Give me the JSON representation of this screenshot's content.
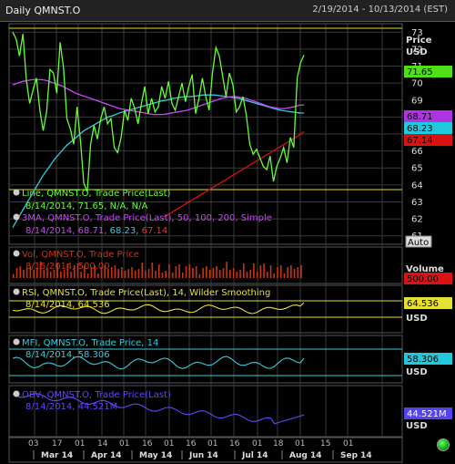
{
  "window": {
    "title": "Daily QMNST.O",
    "range": "2/19/2014 - 10/13/2014 (EST)"
  },
  "colors": {
    "background": "#000000",
    "grid": "#3a3a3a",
    "frame": "#e0e020",
    "price_line": "#66ff33",
    "ma50": "#cc44ff",
    "ma100": "#33ccdd",
    "ma200": "#dd1111",
    "volume": "#cc3311",
    "rsi": "#e6e033",
    "mfi": "#33ccdd",
    "obv": "#6644ff",
    "status_light": "#22cc22"
  },
  "price_panel": {
    "axis_title": "Price",
    "axis_unit": "USD",
    "auto_button": "Auto",
    "ticks": [
      "73",
      "72",
      "71",
      "70",
      "69",
      "68",
      "67",
      "66",
      "65",
      "64",
      "63",
      "62",
      "61"
    ],
    "legend_line1": "Line, QMNST.O, Trade Price(Last)",
    "legend_line1_vals": "8/14/2014, 71.65, N/A, N/A",
    "legend_line2": "3MA, QMNST.O, Trade Price(Last), 50, 100, 200, Simple",
    "legend_line2_date": "8/14/2014",
    "legend_ma50": "68.71",
    "legend_ma100": "68.23",
    "legend_ma200": "67.14",
    "badge_last": "71.65",
    "badge_ma50": "68.71",
    "badge_ma100": "68.23",
    "badge_ma200": "67.14"
  },
  "volume_panel": {
    "legend": "Vol, QMNST.O, Trade Price",
    "legend_vals": "8/15/2014, 500.00",
    "axis_title": "Volume",
    "badge": "500.00"
  },
  "rsi_panel": {
    "legend": "RSI, QMNST.O, Trade Price(Last), 14, Wilder Smoothing",
    "legend_vals": "8/14/2014, 64.536",
    "badge": "64.536",
    "unit": "USD"
  },
  "mfi_panel": {
    "legend": "MFI, QMNST.O, Trade Price, 14",
    "legend_vals": "8/14/2014, 58.306",
    "badge": "58.306",
    "unit": "USD"
  },
  "obv_panel": {
    "legend": "OBV, QMNST.O, Trade Price(Last)",
    "legend_vals": "8/14/2014, 44.521M",
    "badge": "44.521M",
    "unit": "USD"
  },
  "x_axis": {
    "day_ticks": [
      "03",
      "17",
      "01",
      "14",
      "01",
      "16",
      "01",
      "16",
      "01",
      "16",
      "01",
      "18",
      "01",
      "15",
      "01"
    ],
    "month_labels": [
      "Mar 14",
      "Apr 14",
      "May 14",
      "Jun 14",
      "Jul 14",
      "Aug 14",
      "Sep 14"
    ]
  },
  "chart_data": {
    "type": "line",
    "price_ylim": [
      60.5,
      73.5
    ],
    "price_line": [
      73,
      72.6,
      71.6,
      72.9,
      70.2,
      68.8,
      69.6,
      70.3,
      68.4,
      67.2,
      68.3,
      70.8,
      70.6,
      69.4,
      72.4,
      70.9,
      67.9,
      67.3,
      66.4,
      68.6,
      66.6,
      64.1,
      63.6,
      66.4,
      67.5,
      66.7,
      67.9,
      68.6,
      67.6,
      67.9,
      66.2,
      65.9,
      66.8,
      68.4,
      67.8,
      69.1,
      68.5,
      67.6,
      68.8,
      69.8,
      68.2,
      69.1,
      68.3,
      68.6,
      69.8,
      69.1,
      70.1,
      68.8,
      68.4,
      69.2,
      70.0,
      68.9,
      69.8,
      70.5,
      68.2,
      69.1,
      70.3,
      69.2,
      68.4,
      70.6,
      72.1,
      71.6,
      70.4,
      69.2,
      70.6,
      69.9,
      68.3,
      68.6,
      69.2,
      68.1,
      66.4,
      65.8,
      66.1,
      65.6,
      65.1,
      64.9,
      65.7,
      64.2,
      65.1,
      65.6,
      66.2,
      65.3,
      66.8,
      66.2,
      70.3,
      71.2,
      71.65
    ],
    "ma50": [
      69.9,
      70.0,
      70.1,
      70.15,
      70.2,
      70.2,
      70.2,
      70.15,
      70.05,
      69.95,
      69.85,
      69.7,
      69.55,
      69.4,
      69.3,
      69.2,
      69.1,
      69.0,
      68.9,
      68.8,
      68.7,
      68.6,
      68.5,
      68.45,
      68.4,
      68.35,
      68.3,
      68.25,
      68.2,
      68.15,
      68.15,
      68.15,
      68.2,
      68.25,
      68.3,
      68.35,
      68.4,
      68.5,
      68.6,
      68.7,
      68.8,
      68.9,
      69.0,
      69.1,
      69.15,
      69.2,
      69.2,
      69.15,
      69.1,
      69.0,
      68.9,
      68.8,
      68.7,
      68.6,
      68.55,
      68.5,
      68.5,
      68.55,
      68.6,
      68.7,
      68.71
    ],
    "ma100": [
      61.5,
      62.1,
      62.7,
      63.3,
      63.9,
      64.5,
      65.0,
      65.5,
      65.9,
      66.3,
      66.6,
      66.9,
      67.2,
      67.4,
      67.6,
      67.8,
      68.0,
      68.1,
      68.25,
      68.35,
      68.45,
      68.55,
      68.65,
      68.75,
      68.85,
      68.95,
      69.0,
      69.1,
      69.15,
      69.2,
      69.2,
      69.25,
      69.3,
      69.3,
      69.3,
      69.25,
      69.2,
      69.15,
      69.1,
      69.0,
      68.9,
      68.8,
      68.7,
      68.6,
      68.5,
      68.4,
      68.35,
      68.3,
      68.25,
      68.23
    ],
    "ma200": [
      62.1,
      62.3,
      62.5,
      62.7,
      62.9,
      63.1,
      63.3,
      63.5,
      63.7,
      63.9,
      64.1,
      64.3,
      64.5,
      64.7,
      64.9,
      65.1,
      65.3,
      65.5,
      65.7,
      65.9,
      66.1,
      66.3,
      66.5,
      66.7,
      66.9,
      67.14
    ],
    "volume_last": 500.0,
    "rsi_last": 64.536,
    "mfi_last": 58.306,
    "obv_last": "44.521M"
  }
}
